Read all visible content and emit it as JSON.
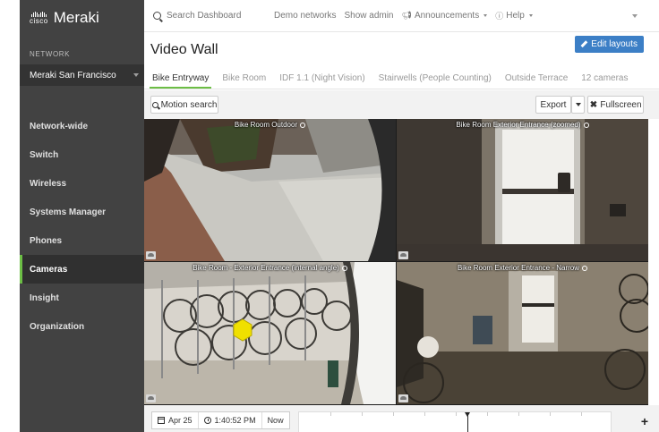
{
  "brand": {
    "logo_word": "cisco",
    "product": "Meraki"
  },
  "sidebar": {
    "network_label": "NETWORK",
    "network_name": "Meraki San Francisco",
    "items": [
      {
        "label": "Network-wide"
      },
      {
        "label": "Switch"
      },
      {
        "label": "Wireless"
      },
      {
        "label": "Systems Manager"
      },
      {
        "label": "Phones"
      },
      {
        "label": "Cameras",
        "active": true
      },
      {
        "label": "Insight"
      },
      {
        "label": "Organization"
      }
    ]
  },
  "topbar": {
    "search_placeholder": "Search Dashboard",
    "links": [
      "Demo networks",
      "Show admin",
      "Announcements",
      "Help"
    ]
  },
  "page": {
    "title": "Video Wall",
    "edit_label": "Edit layouts"
  },
  "tabs": [
    {
      "label": "Bike Entryway",
      "active": true
    },
    {
      "label": "Bike Room"
    },
    {
      "label": "IDF 1.1 (Night Vision)"
    },
    {
      "label": "Stairwells (People Counting)"
    },
    {
      "label": "Outside Terrace"
    },
    {
      "label": "12 cameras"
    }
  ],
  "toolbar": {
    "motion_label": "Motion search",
    "export_label": "Export",
    "fullscreen_label": "Fullscreen"
  },
  "cameras": [
    {
      "title": "Bike Room Outdoor"
    },
    {
      "title": "Bike Room Exterior Entrance (zoomed)"
    },
    {
      "title": "Bike Room - Exterior Entrance (internal angle)"
    },
    {
      "title": "Bike Room Exterior Entrance - Narrow"
    }
  ],
  "timeline": {
    "date": "Apr 25",
    "time": "1:40:52 PM",
    "now_label": "Now"
  },
  "colors": {
    "sidebar_bg": "#424242",
    "accent_green": "#6cbe45",
    "primary_blue": "#3c7fc6"
  }
}
